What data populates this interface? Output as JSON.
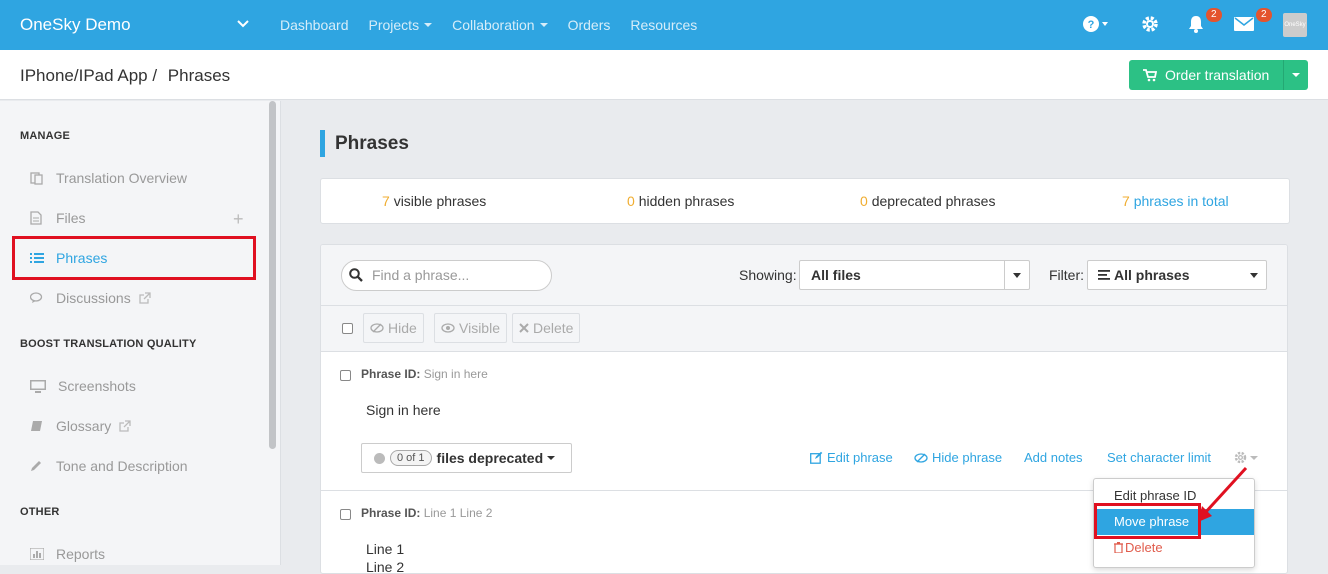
{
  "topbar": {
    "brand": "OneSky Demo",
    "nav": [
      {
        "label": "Dashboard",
        "has_caret": false
      },
      {
        "label": "Projects",
        "has_caret": true
      },
      {
        "label": "Collaboration",
        "has_caret": true
      },
      {
        "label": "Orders",
        "has_caret": false
      },
      {
        "label": "Resources",
        "has_caret": false
      }
    ],
    "notifications_count": "2",
    "messages_count": "2",
    "avatar_text": "OneSky",
    "bg_color": "#2fa5e1"
  },
  "subheader": {
    "breadcrumb_project": "IPhone/IPad App /",
    "breadcrumb_page": "Phrases",
    "order_button": "Order translation",
    "order_color": "#2cc185"
  },
  "sidebar": {
    "manage_title": "MANAGE",
    "manage_items": [
      {
        "label": "Translation Overview",
        "icon": "translation-overview-icon"
      },
      {
        "label": "Files",
        "icon": "file-icon"
      },
      {
        "label": "Phrases",
        "icon": "list-icon",
        "active": true
      },
      {
        "label": "Discussions",
        "icon": "chat-icon",
        "external": true
      }
    ],
    "quality_title": "BOOST TRANSLATION QUALITY",
    "quality_items": [
      {
        "label": "Screenshots",
        "icon": "monitor-icon"
      },
      {
        "label": "Glossary",
        "icon": "book-icon",
        "external": true
      },
      {
        "label": "Tone and Description",
        "icon": "pencil-icon"
      }
    ],
    "other_title": "OTHER",
    "other_items": [
      {
        "label": "Reports",
        "icon": "bar-chart-icon"
      }
    ]
  },
  "main": {
    "title": "Phrases",
    "stats": {
      "visible_count": "7",
      "visible_label": "visible phrases",
      "hidden_count": "0",
      "hidden_label": "hidden phrases",
      "deprecated_count": "0",
      "deprecated_label": "deprecated phrases",
      "total_count": "7",
      "total_label": "phrases in total"
    },
    "search_placeholder": "Find a phrase...",
    "showing_label": "Showing:",
    "showing_value": "All files",
    "filter_label": "Filter:",
    "filter_value": "All phrases",
    "bulk": {
      "hide": "Hide",
      "visible": "Visible",
      "delete": "Delete"
    },
    "phrases": [
      {
        "id_label": "Phrase ID:",
        "id": "Sign in here",
        "text_lines": [
          "Sign in here"
        ],
        "deprecated_pill": "0 of 1",
        "deprecated_label": "files deprecated",
        "actions": {
          "edit": "Edit phrase",
          "hide": "Hide phrase",
          "notes": "Add notes",
          "limit": "Set character limit"
        }
      },
      {
        "id_label": "Phrase ID:",
        "id": "Line 1 Line 2",
        "text_lines": [
          "Line 1",
          "Line 2"
        ]
      }
    ],
    "dropdown": {
      "edit_id": "Edit phrase ID",
      "move": "Move phrase",
      "delete": "Delete"
    }
  }
}
